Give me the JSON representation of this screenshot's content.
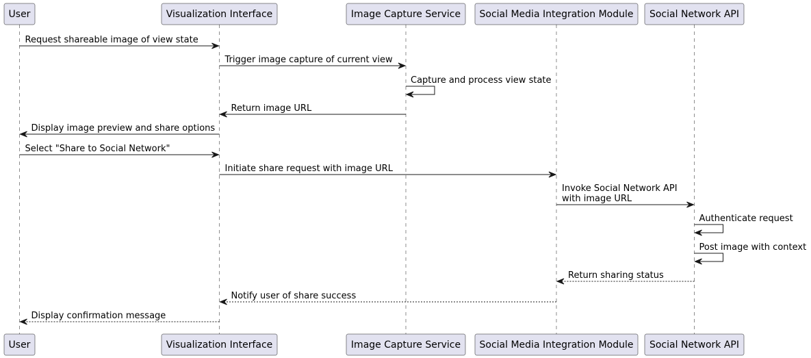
{
  "participants": [
    {
      "name": "User"
    },
    {
      "name": "Visualization Interface"
    },
    {
      "name": "Image Capture Service"
    },
    {
      "name": "Social Media Integration Module"
    },
    {
      "name": "Social Network API"
    }
  ],
  "messages": [
    {
      "from": 0,
      "to": 1,
      "text": [
        "Request shareable image of view state"
      ],
      "style": "solid"
    },
    {
      "from": 1,
      "to": 2,
      "text": [
        "Trigger image capture of current view"
      ],
      "style": "solid"
    },
    {
      "from": 2,
      "to": 2,
      "text": [
        "Capture and process view state"
      ],
      "style": "solid"
    },
    {
      "from": 2,
      "to": 1,
      "text": [
        "Return image URL"
      ],
      "style": "solid"
    },
    {
      "from": 1,
      "to": 0,
      "text": [
        "Display image preview and share options"
      ],
      "style": "solid"
    },
    {
      "from": 0,
      "to": 1,
      "text": [
        "Select \"Share to Social Network\""
      ],
      "style": "solid"
    },
    {
      "from": 1,
      "to": 3,
      "text": [
        "Initiate share request with image URL"
      ],
      "style": "solid"
    },
    {
      "from": 3,
      "to": 4,
      "text": [
        "Invoke Social Network API",
        "with image URL"
      ],
      "style": "solid"
    },
    {
      "from": 4,
      "to": 4,
      "text": [
        "Authenticate request"
      ],
      "style": "solid"
    },
    {
      "from": 4,
      "to": 4,
      "text": [
        "Post image with context"
      ],
      "style": "solid"
    },
    {
      "from": 4,
      "to": 3,
      "text": [
        "Return sharing status"
      ],
      "style": "dashed"
    },
    {
      "from": 3,
      "to": 1,
      "text": [
        "Notify user of share success"
      ],
      "style": "dashed"
    },
    {
      "from": 1,
      "to": 0,
      "text": [
        "Display confirmation message"
      ],
      "style": "dashed"
    }
  ],
  "colors": {
    "participant_fill": "#e2e2f0",
    "line": "#181818"
  }
}
